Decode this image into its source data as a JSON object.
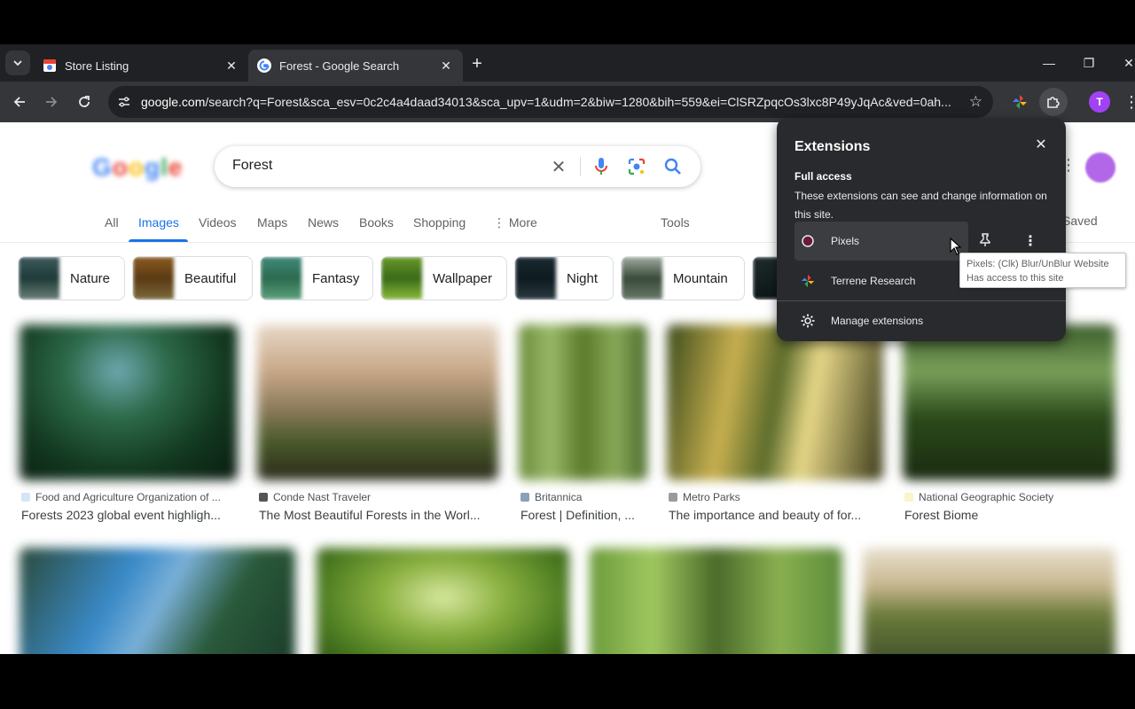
{
  "browser": {
    "tabs": [
      {
        "title": "Store Listing",
        "active": false
      },
      {
        "title": "Forest - Google Search",
        "active": true
      }
    ],
    "url_host": "google.com",
    "url_rest": "/search?q=Forest&sca_esv=0c2c4a4daad34013&sca_upv=1&udm=2&biw=1280&bih=559&ei=ClSRZpqcOs3lxc8P49yJqAc&ved=0ah...",
    "profile_initial": "T"
  },
  "google": {
    "logo_letters": [
      "G",
      "o",
      "o",
      "g",
      "l",
      "e"
    ],
    "query": "Forest",
    "nav": [
      "All",
      "Images",
      "Videos",
      "Maps",
      "News",
      "Books",
      "Shopping",
      "More",
      "Tools"
    ],
    "active_nav": "Images",
    "saved_label": "Saved",
    "chips": [
      "Nature",
      "Beautiful",
      "Fantasy",
      "Wallpaper",
      "Night",
      "Mountain"
    ],
    "results": [
      {
        "source": "Food and Agriculture Organization of ...",
        "caption": "Forests 2023 global event highligh..."
      },
      {
        "source": "Conde Nast Traveler",
        "caption": "The Most Beautiful Forests in the Worl..."
      },
      {
        "source": "Britannica",
        "caption": "Forest | Definition, ..."
      },
      {
        "source": "Metro Parks",
        "caption": "The importance and beauty of for..."
      },
      {
        "source": "National Geographic Society",
        "caption": "Forest Biome"
      }
    ]
  },
  "extensions_popup": {
    "title": "Extensions",
    "section": "Full access",
    "description": "These extensions can see and change information on this site.",
    "items": [
      {
        "name": "Pixels"
      },
      {
        "name": "Terrene Research"
      }
    ],
    "manage_label": "Manage extensions",
    "tooltip_line1": "Pixels: (Clk) Blur/UnBlur Website",
    "tooltip_line2": "Has access to this site"
  },
  "colors": {
    "accent": "#1a73e8",
    "popup_bg": "#292a2d",
    "profile": "#a142f4"
  }
}
